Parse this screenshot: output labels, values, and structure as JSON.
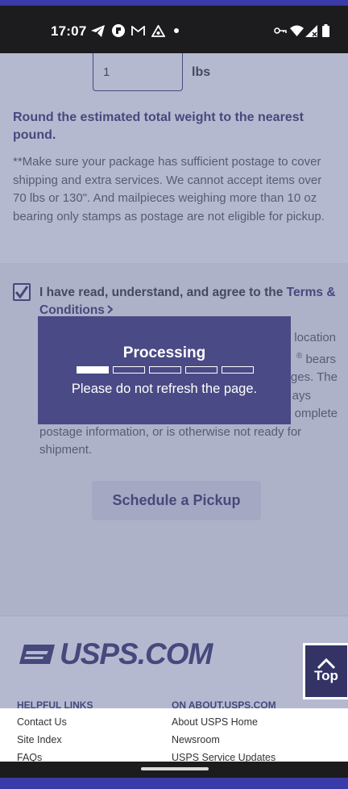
{
  "status_bar": {
    "time": "17:07"
  },
  "form": {
    "weight_value": "1",
    "weight_unit": "lbs",
    "round_note": "Round the estimated total weight to the nearest pound.",
    "postage_note": "**Make sure your package has sufficient postage to cover shipping and extra services. We cannot accept items over 70 lbs or 130\". And mailpieces weighing more than 10 oz bearing only stamps as postage are not eligible for pickup.",
    "agree_prefix": "I have read, understand, and agree to the ",
    "terms_link": "Terms & Conditions",
    "agree_checked": true,
    "terms_tail_line": "location",
    "terms_partial_1": "bears",
    "terms_partial_2": "ges. The",
    "terms_partial_3": "ays",
    "terms_partial_4": "omplete",
    "terms_last_lines": "postage information, or is otherwise not ready for shipment.",
    "schedule_button": "Schedule a Pickup"
  },
  "footer": {
    "logo_text": "USPS.COM",
    "helpful_links_heading": "HELPFUL LINKS",
    "helpful_links": [
      "Contact Us",
      "Site Index",
      "FAQs"
    ],
    "about_heading": "ON ABOUT.USPS.COM",
    "about_links": [
      "About USPS Home",
      "Newsroom",
      "USPS Service Updates"
    ]
  },
  "top_button": {
    "label": "Top"
  },
  "processing_modal": {
    "title": "Processing",
    "message": "Please do not refresh the page.",
    "progress_fraction": 0.2,
    "segments": 5
  },
  "colors": {
    "usps_navy": "#333366",
    "modal_bg": "#4a4a86",
    "accent_blue": "#3a3aa8"
  }
}
